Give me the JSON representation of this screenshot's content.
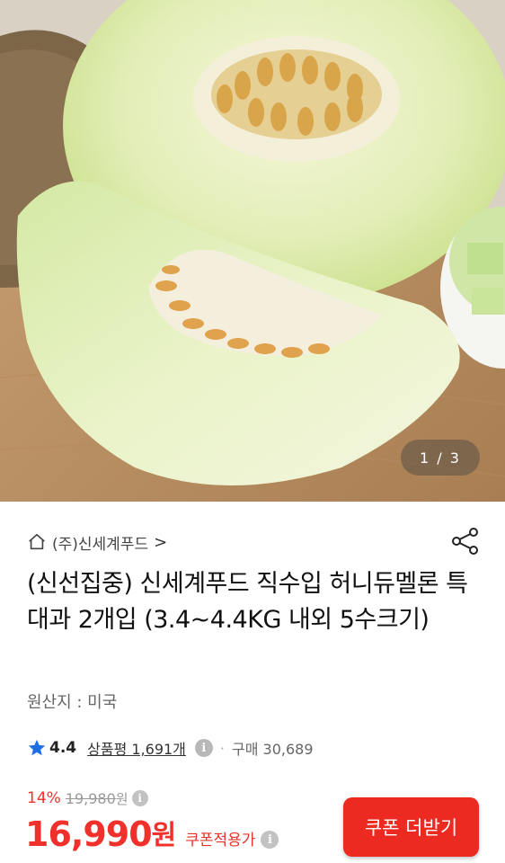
{
  "hero": {
    "counter": "1 / 3",
    "icon": "honeydew-melon-photo"
  },
  "seller": {
    "name": "(주)신세계푸드",
    "chevron": ">",
    "icon": "home-icon"
  },
  "share_icon": "share-icon",
  "product": {
    "title": "(신선집중) 신세계푸드 직수입 허니듀멜론 특대과 2개입 (3.4~4.4KG 내외 5수크기)",
    "origin": "원산지 : 미국"
  },
  "rating": {
    "score": "4.4",
    "review_label": "상품평 1,691개",
    "dot": "·",
    "purchase": "구매 30,689",
    "star_color": "#1d6fe3"
  },
  "price": {
    "discount": "14%",
    "original": "19,980",
    "original_unit": "원",
    "sale": "16,990",
    "sale_unit": "원",
    "coupon_price_label": "쿠폰적용가"
  },
  "coupon_button": {
    "label": "쿠폰 더받기"
  },
  "colors": {
    "accent_red": "#ec2a22",
    "price_red": "#f0302a"
  }
}
